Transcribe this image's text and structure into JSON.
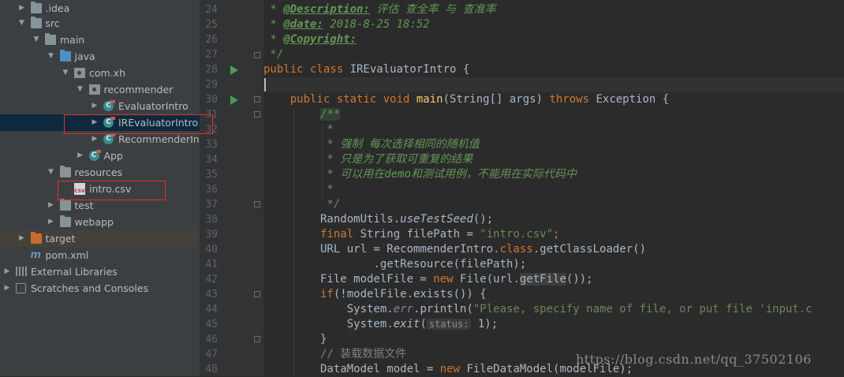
{
  "project_tree": [
    {
      "label": ".idea",
      "depth": 1,
      "arrow": "▶",
      "icon": "folder"
    },
    {
      "label": "src",
      "depth": 1,
      "arrow": "▼",
      "icon": "folder"
    },
    {
      "label": "main",
      "depth": 2,
      "arrow": "▼",
      "icon": "folder"
    },
    {
      "label": "java",
      "depth": 3,
      "arrow": "▼",
      "icon": "folder-blue"
    },
    {
      "label": "com.xh",
      "depth": 4,
      "arrow": "▼",
      "icon": "package"
    },
    {
      "label": "recommender",
      "depth": 5,
      "arrow": "▼",
      "icon": "package"
    },
    {
      "label": "EvaluatorIntro",
      "depth": 6,
      "arrow": "▶",
      "icon": "class"
    },
    {
      "label": "IREvaluatorIntro",
      "depth": 6,
      "arrow": "▶",
      "icon": "class",
      "selected": true
    },
    {
      "label": "RecommenderIntro",
      "depth": 6,
      "arrow": "▶",
      "icon": "class"
    },
    {
      "label": "App",
      "depth": 5,
      "arrow": "▶",
      "icon": "class"
    },
    {
      "label": "resources",
      "depth": 3,
      "arrow": "▼",
      "icon": "folder-res"
    },
    {
      "label": "intro.csv",
      "depth": 4,
      "arrow": "",
      "icon": "csv"
    },
    {
      "label": "test",
      "depth": 3,
      "arrow": "▶",
      "icon": "folder"
    },
    {
      "label": "webapp",
      "depth": 3,
      "arrow": "▶",
      "icon": "folder"
    },
    {
      "label": "target",
      "depth": 1,
      "arrow": "▶",
      "icon": "folder-orange",
      "highlight": true
    },
    {
      "label": "pom.xml",
      "depth": 1,
      "arrow": "",
      "icon": "maven"
    },
    {
      "label": "External Libraries",
      "depth": 0,
      "arrow": "▶",
      "icon": "library"
    },
    {
      "label": "Scratches and Consoles",
      "depth": 0,
      "arrow": "▶",
      "icon": "scratch"
    }
  ],
  "class_icon_letter": "C",
  "maven_icon_letter": "m",
  "csv_icon_text": "CSV",
  "line_numbers": [
    "24",
    "25",
    "26",
    "27",
    "28",
    "29",
    "30",
    "31",
    "32",
    "33",
    "34",
    "35",
    "36",
    "37",
    "38",
    "39",
    "40",
    "41",
    "42",
    "43",
    "44",
    "45",
    "46",
    "47",
    "48"
  ],
  "code": {
    "l24_prefix": " * ",
    "l24_tag": "@Description:",
    "l24_text": " 评估 查全率 与 查准率",
    "l25_prefix": " * ",
    "l25_tag": "@date:",
    "l25_text": " 2018-8-25 18:52",
    "l26_prefix": " * ",
    "l26_tag": "@Copyright:",
    "l27": " */",
    "l28_kw": "public class ",
    "l28_name": "IREvaluatorIntro {",
    "l30_kw": "    public static void ",
    "l30_fn": "main",
    "l30_args": "(String[] args) ",
    "l30_throws": "throws",
    "l30_exc": " Exception {",
    "l31": "/**",
    "l32": " *",
    "l33": " * 强制 每次选择相同的随机值",
    "l34": " * 只是为了获取可重复的结果",
    "l35_a": " * 可以用在",
    "l35_b": "demo",
    "l35_c": "和测试用例，不能用在实际代码中",
    "l36": " *",
    "l37": " */",
    "l38_a": "RandomUtils.",
    "l38_b": "useTestSeed",
    "l38_c": "();",
    "l39_kw": "final ",
    "l39_a": "String filePath = ",
    "l39_str": "\"intro.csv\"",
    "l39_c": ";",
    "l40_a": "URL url = RecommenderIntro.",
    "l40_kw": "class",
    "l40_b": ".getClassLoader()",
    "l41": "        .getResource(filePath);",
    "l42_a": "File modelFile = ",
    "l42_kw": "new ",
    "l42_b": "File(url.",
    "l42_hl": "getFile",
    "l42_c": "());",
    "l43_kw": "if",
    "l43_a": "(!modelFile.exists()) {",
    "l44_a": "    System.",
    "l44_err": "err",
    "l44_b": ".println(",
    "l44_str": "\"Please, specify name of file, or put file 'input.c",
    "l45_a": "    System.",
    "l45_exit": "exit",
    "l45_b": "(",
    "l45_hint": "status:",
    "l45_c": " 1);",
    "l46": "}",
    "l47": "// 装载数据文件",
    "l48_a": "DataModel model = ",
    "l48_kw": "new ",
    "l48_b": "FileDataModel(modelFile);"
  },
  "watermark": "https://blog.csdn.net/qq_37502106"
}
